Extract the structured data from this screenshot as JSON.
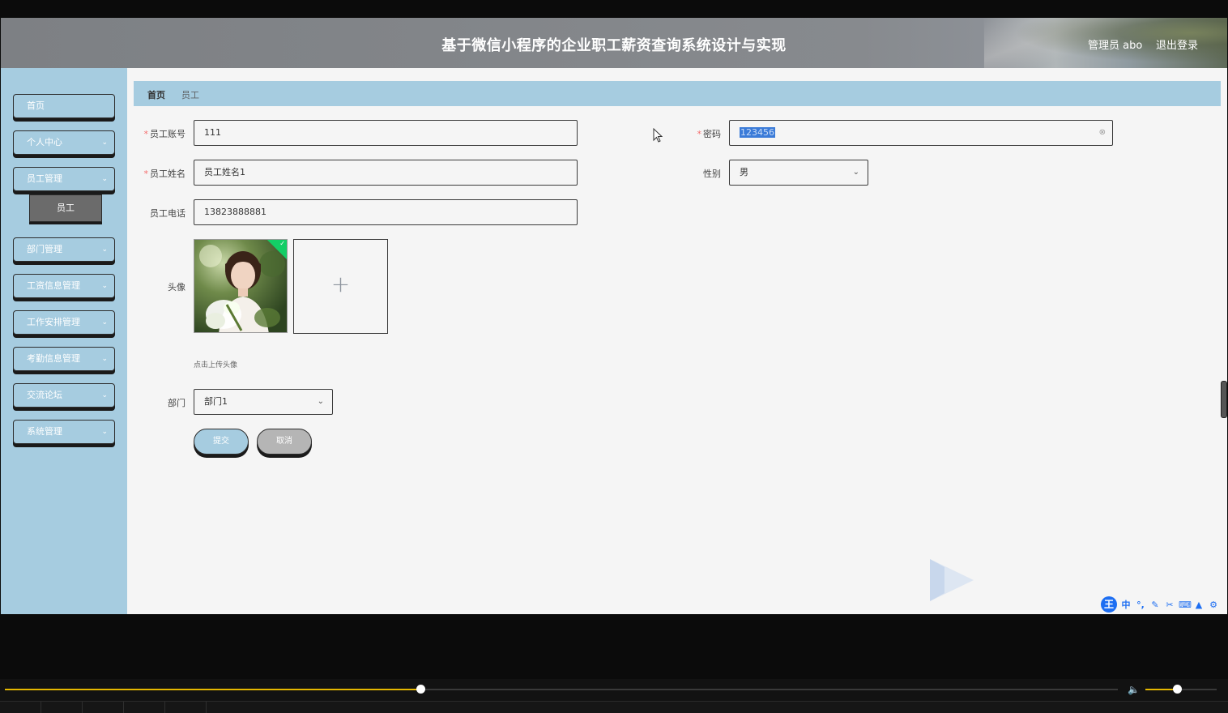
{
  "header": {
    "title": "基于微信小程序的企业职工薪资查询系统设计与实现",
    "user": "管理员 abo",
    "logout": "退出登录"
  },
  "sidebar": {
    "items": [
      {
        "label": "首页",
        "has_chevron": false
      },
      {
        "label": "个人中心",
        "has_chevron": true
      },
      {
        "label": "员工管理",
        "has_chevron": true
      },
      {
        "label": "部门管理",
        "has_chevron": true
      },
      {
        "label": "工资信息管理",
        "has_chevron": true
      },
      {
        "label": "工作安排管理",
        "has_chevron": true
      },
      {
        "label": "考勤信息管理",
        "has_chevron": true
      },
      {
        "label": "交流论坛",
        "has_chevron": true
      },
      {
        "label": "系统管理",
        "has_chevron": true
      }
    ],
    "active_submenu": "员工"
  },
  "breadcrumb": {
    "home": "首页",
    "current": "员工"
  },
  "form": {
    "account_label": "员工账号",
    "account_value": "111",
    "password_label": "密码",
    "password_value": "123456",
    "name_label": "员工姓名",
    "name_value": "员工姓名1",
    "gender_label": "性别",
    "gender_value": "男",
    "phone_label": "员工电话",
    "phone_value": "13823888881",
    "avatar_label": "头像",
    "avatar_hint": "点击上传头像",
    "department_label": "部门",
    "department_value": "部门1",
    "submit": "提交",
    "cancel": "取消"
  },
  "ime": {
    "logo": "王",
    "mode": "中"
  },
  "player": {
    "progress": 0.373,
    "volume": 0.44
  },
  "colors": {
    "accent": "#a6cce0",
    "required": "#f56c6c",
    "success": "#13ce66",
    "progress": "#e6b800"
  }
}
